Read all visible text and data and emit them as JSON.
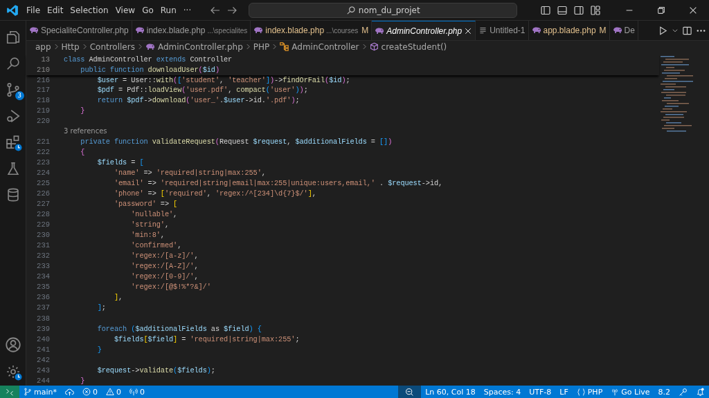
{
  "title_bar": {
    "menus": [
      "File",
      "Edit",
      "Selection",
      "View",
      "Go",
      "Run",
      "···"
    ],
    "search": {
      "value": "nom_du_projet"
    }
  },
  "activity_bar": {
    "items": [
      {
        "kind": "files",
        "selected": false
      },
      {
        "kind": "search",
        "selected": false
      },
      {
        "kind": "source-control",
        "selected": false,
        "badge": "3"
      },
      {
        "kind": "run",
        "selected": false
      },
      {
        "kind": "extensions",
        "selected": false,
        "clock": true
      },
      {
        "kind": "testing",
        "selected": false
      },
      {
        "kind": "database",
        "selected": false
      }
    ],
    "bottom": [
      {
        "kind": "account"
      },
      {
        "kind": "settings",
        "clock": true
      }
    ]
  },
  "tabs": [
    {
      "kind": "php",
      "label": "SpecialiteController.php",
      "selected": false,
      "preview": false,
      "modified": false
    },
    {
      "kind": "php",
      "label": "index.blade.php",
      "description": "...\\specialites",
      "selected": false,
      "preview": false,
      "modified": false
    },
    {
      "kind": "php",
      "label": "index.blade.php",
      "description": "...\\courses",
      "badge": "M",
      "selected": false,
      "preview": false,
      "modified": true
    },
    {
      "kind": "php",
      "label": "AdminController.php",
      "selected": true,
      "preview": true,
      "modified": false
    },
    {
      "kind": "text",
      "label": "Untitled-1",
      "selected": false,
      "preview": false,
      "modified": false
    },
    {
      "kind": "php",
      "label": "app.blade.php",
      "badge": "M",
      "selected": false,
      "preview": false,
      "modified": true
    },
    {
      "kind": "php",
      "label": "De",
      "selected": false,
      "preview": false,
      "modified": false
    }
  ],
  "breadcrumb": [
    {
      "kind": "folder",
      "text": "app"
    },
    {
      "kind": "folder",
      "text": "Http"
    },
    {
      "kind": "folder",
      "text": "Controllers"
    },
    {
      "kind": "php",
      "text": "AdminController.php"
    },
    {
      "kind": "folder",
      "text": "PHP"
    },
    {
      "kind": "class",
      "text": "AdminController"
    },
    {
      "kind": "method",
      "text": "createStudent()"
    }
  ],
  "sticky_lines": [
    {
      "num": "13",
      "tokens": [
        {
          "kind": "kw",
          "text": "class "
        },
        {
          "kind": "plain",
          "text": "AdminController "
        },
        {
          "kind": "kw",
          "text": "extends "
        },
        {
          "kind": "plain",
          "text": "Controller"
        }
      ]
    },
    {
      "num": "210",
      "tokens": [
        {
          "kind": "kw",
          "text": "    public function "
        },
        {
          "kind": "fn",
          "text": "downloadUser"
        },
        {
          "kind": "b2",
          "text": "("
        },
        {
          "kind": "var",
          "text": "$id"
        },
        {
          "kind": "b2",
          "text": ")"
        }
      ]
    }
  ],
  "lines": [
    {
      "kind": "code",
      "num": "216",
      "tokens": [
        {
          "kind": "var",
          "text": "        $user"
        },
        {
          "kind": "plain",
          "text": " = User::"
        },
        {
          "kind": "fn",
          "text": "with"
        },
        {
          "kind": "b2",
          "text": "("
        },
        {
          "kind": "b3",
          "text": "["
        },
        {
          "kind": "str",
          "text": "'student'"
        },
        {
          "kind": "plain",
          "text": ", "
        },
        {
          "kind": "str",
          "text": "'teacher'"
        },
        {
          "kind": "b3",
          "text": "]"
        },
        {
          "kind": "b2",
          "text": ")"
        },
        {
          "kind": "plain",
          "text": "->"
        },
        {
          "kind": "fn",
          "text": "findOrFail"
        },
        {
          "kind": "b2",
          "text": "("
        },
        {
          "kind": "var",
          "text": "$id"
        },
        {
          "kind": "b2",
          "text": ")"
        },
        {
          "kind": "plain",
          "text": ";"
        }
      ]
    },
    {
      "kind": "code",
      "num": "217",
      "tokens": [
        {
          "kind": "var",
          "text": "        $pdf"
        },
        {
          "kind": "plain",
          "text": " = Pdf::"
        },
        {
          "kind": "fn",
          "text": "loadView"
        },
        {
          "kind": "b2",
          "text": "("
        },
        {
          "kind": "str",
          "text": "'user.pdf'"
        },
        {
          "kind": "plain",
          "text": ", "
        },
        {
          "kind": "fn",
          "text": "compact"
        },
        {
          "kind": "b3",
          "text": "("
        },
        {
          "kind": "str",
          "text": "'user'"
        },
        {
          "kind": "b3",
          "text": ")"
        },
        {
          "kind": "b2",
          "text": ")"
        },
        {
          "kind": "plain",
          "text": ";"
        }
      ]
    },
    {
      "kind": "code",
      "num": "218",
      "tokens": [
        {
          "kind": "kw",
          "text": "        return "
        },
        {
          "kind": "var",
          "text": "$pdf"
        },
        {
          "kind": "plain",
          "text": "->"
        },
        {
          "kind": "fn",
          "text": "download"
        },
        {
          "kind": "b2",
          "text": "("
        },
        {
          "kind": "str",
          "text": "'user_'"
        },
        {
          "kind": "plain",
          "text": "."
        },
        {
          "kind": "var",
          "text": "$user"
        },
        {
          "kind": "plain",
          "text": "->id."
        },
        {
          "kind": "str",
          "text": "'.pdf'"
        },
        {
          "kind": "b2",
          "text": ")"
        },
        {
          "kind": "plain",
          "text": ";"
        }
      ]
    },
    {
      "kind": "code",
      "num": "219",
      "tokens": [
        {
          "kind": "b2",
          "text": "    }"
        }
      ]
    },
    {
      "kind": "code",
      "num": "220"
    },
    {
      "kind": "codelens",
      "text": "3 references"
    },
    {
      "kind": "code",
      "num": "221",
      "tokens": [
        {
          "kind": "kw",
          "text": "    private function "
        },
        {
          "kind": "fn",
          "text": "validateRequest"
        },
        {
          "kind": "b2",
          "text": "("
        },
        {
          "kind": "plain",
          "text": "Request "
        },
        {
          "kind": "var",
          "text": "$request"
        },
        {
          "kind": "plain",
          "text": ", "
        },
        {
          "kind": "var",
          "text": "$additionalFields"
        },
        {
          "kind": "plain",
          "text": " = "
        },
        {
          "kind": "b3",
          "text": "[]"
        },
        {
          "kind": "b2",
          "text": ")"
        }
      ]
    },
    {
      "kind": "code",
      "num": "222",
      "tokens": [
        {
          "kind": "b2",
          "text": "    {"
        }
      ]
    },
    {
      "kind": "code",
      "num": "223",
      "tokens": [
        {
          "kind": "var",
          "text": "        $fields"
        },
        {
          "kind": "plain",
          "text": " = "
        },
        {
          "kind": "b3",
          "text": "["
        }
      ]
    },
    {
      "kind": "code",
      "num": "224",
      "tokens": [
        {
          "kind": "str",
          "text": "            'name'"
        },
        {
          "kind": "plain",
          "text": " => "
        },
        {
          "kind": "str",
          "text": "'required|string|max:255'"
        },
        {
          "kind": "plain",
          "text": ","
        }
      ]
    },
    {
      "kind": "code",
      "num": "225",
      "tokens": [
        {
          "kind": "str",
          "text": "            'email'"
        },
        {
          "kind": "plain",
          "text": " => "
        },
        {
          "kind": "str",
          "text": "'required|string|email|max:255|unique:users,email,'"
        },
        {
          "kind": "plain",
          "text": " . "
        },
        {
          "kind": "var",
          "text": "$request"
        },
        {
          "kind": "plain",
          "text": "->id,"
        }
      ]
    },
    {
      "kind": "code",
      "num": "226",
      "tokens": [
        {
          "kind": "str",
          "text": "            'phone'"
        },
        {
          "kind": "plain",
          "text": " => "
        },
        {
          "kind": "b1",
          "text": "["
        },
        {
          "kind": "str",
          "text": "'required'"
        },
        {
          "kind": "plain",
          "text": ", "
        },
        {
          "kind": "str",
          "text": "'regex:/^[234]\\d{7}$/'"
        },
        {
          "kind": "b1",
          "text": "]"
        },
        {
          "kind": "plain",
          "text": ","
        }
      ]
    },
    {
      "kind": "code",
      "num": "227",
      "tokens": [
        {
          "kind": "str",
          "text": "            'password'"
        },
        {
          "kind": "plain",
          "text": " => "
        },
        {
          "kind": "b1",
          "text": "["
        }
      ]
    },
    {
      "kind": "code",
      "num": "228",
      "tokens": [
        {
          "kind": "str",
          "text": "                'nullable'"
        },
        {
          "kind": "plain",
          "text": ","
        }
      ]
    },
    {
      "kind": "code",
      "num": "229",
      "tokens": [
        {
          "kind": "str",
          "text": "                'string'"
        },
        {
          "kind": "plain",
          "text": ","
        }
      ]
    },
    {
      "kind": "code",
      "num": "230",
      "tokens": [
        {
          "kind": "str",
          "text": "                'min:8'"
        },
        {
          "kind": "plain",
          "text": ","
        }
      ]
    },
    {
      "kind": "code",
      "num": "231",
      "tokens": [
        {
          "kind": "str",
          "text": "                'confirmed'"
        },
        {
          "kind": "plain",
          "text": ","
        }
      ]
    },
    {
      "kind": "code",
      "num": "232",
      "tokens": [
        {
          "kind": "str",
          "text": "                'regex:/[a-z]/'"
        },
        {
          "kind": "plain",
          "text": ","
        }
      ]
    },
    {
      "kind": "code",
      "num": "233",
      "tokens": [
        {
          "kind": "str",
          "text": "                'regex:/[A-Z]/'"
        },
        {
          "kind": "plain",
          "text": ","
        }
      ]
    },
    {
      "kind": "code",
      "num": "234",
      "tokens": [
        {
          "kind": "str",
          "text": "                'regex:/[0-9]/'"
        },
        {
          "kind": "plain",
          "text": ","
        }
      ]
    },
    {
      "kind": "code",
      "num": "235",
      "tokens": [
        {
          "kind": "str",
          "text": "                'regex:/[@$!%*?&]/'"
        }
      ]
    },
    {
      "kind": "code",
      "num": "236",
      "tokens": [
        {
          "kind": "b1",
          "text": "            ]"
        },
        {
          "kind": "plain",
          "text": ","
        }
      ]
    },
    {
      "kind": "code",
      "num": "237",
      "tokens": [
        {
          "kind": "b3",
          "text": "        ]"
        },
        {
          "kind": "plain",
          "text": ";"
        }
      ]
    },
    {
      "kind": "code",
      "num": "238"
    },
    {
      "kind": "code",
      "num": "239",
      "tokens": [
        {
          "kind": "kw",
          "text": "        foreach "
        },
        {
          "kind": "b3",
          "text": "("
        },
        {
          "kind": "var",
          "text": "$additionalFields"
        },
        {
          "kind": "plain",
          "text": " as "
        },
        {
          "kind": "var",
          "text": "$field"
        },
        {
          "kind": "b3",
          "text": ")"
        },
        {
          "kind": "b3",
          "text": " {"
        }
      ]
    },
    {
      "kind": "code",
      "num": "240",
      "tokens": [
        {
          "kind": "var",
          "text": "            $fields"
        },
        {
          "kind": "b1",
          "text": "["
        },
        {
          "kind": "var",
          "text": "$field"
        },
        {
          "kind": "b1",
          "text": "]"
        },
        {
          "kind": "plain",
          "text": " = "
        },
        {
          "kind": "str",
          "text": "'required|string|max:255'"
        },
        {
          "kind": "plain",
          "text": ";"
        }
      ]
    },
    {
      "kind": "code",
      "num": "241",
      "tokens": [
        {
          "kind": "b3",
          "text": "        }"
        }
      ]
    },
    {
      "kind": "code",
      "num": "242"
    },
    {
      "kind": "code",
      "num": "243",
      "tokens": [
        {
          "kind": "var",
          "text": "        $request"
        },
        {
          "kind": "plain",
          "text": "->"
        },
        {
          "kind": "fn",
          "text": "validate"
        },
        {
          "kind": "b3",
          "text": "("
        },
        {
          "kind": "var",
          "text": "$fields"
        },
        {
          "kind": "b3",
          "text": ")"
        },
        {
          "kind": "plain",
          "text": ";"
        }
      ]
    },
    {
      "kind": "code",
      "num": "244",
      "tokens": [
        {
          "kind": "b2",
          "text": "    }"
        }
      ]
    }
  ],
  "status_bar": {
    "left": [
      {
        "kind": "branch",
        "text": "main*"
      },
      {
        "kind": "sync"
      },
      {
        "kind": "errors",
        "text": "0"
      },
      {
        "kind": "warnings",
        "text": "0"
      },
      {
        "kind": "ports",
        "text": "0"
      }
    ],
    "right": [
      {
        "kind": "zoom"
      },
      {
        "kind": "text",
        "text": "Ln 60, Col 18"
      },
      {
        "kind": "text",
        "text": "Spaces: 4"
      },
      {
        "kind": "text",
        "text": "UTF-8"
      },
      {
        "kind": "text",
        "text": "LF"
      },
      {
        "kind": "language",
        "text": "PHP"
      },
      {
        "kind": "live",
        "text": "Go Live"
      },
      {
        "kind": "text",
        "text": "8.2"
      },
      {
        "kind": "key"
      },
      {
        "kind": "bell"
      }
    ]
  }
}
